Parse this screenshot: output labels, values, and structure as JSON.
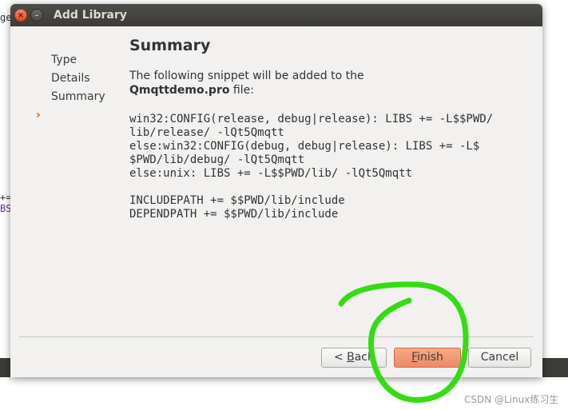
{
  "background": {
    "fragment_top": "ge",
    "fragment_mid1": "+=",
    "fragment_mid2": "BS"
  },
  "dialog": {
    "title": "Add Library",
    "close_glyph": "×",
    "minimize_glyph": "–"
  },
  "nav": {
    "items": [
      "Type",
      "Details",
      "Summary"
    ],
    "current_marker": "›"
  },
  "content": {
    "heading": "Summary",
    "intro_line1": "The following snippet will be added to the",
    "intro_file": "Qmqttdemo.pro",
    "intro_suffix": " file:",
    "snippet": "win32:CONFIG(release, debug|release): LIBS += -L$$PWD/\nlib/release/ -lQt5Qmqtt\nelse:win32:CONFIG(debug, debug|release): LIBS += -L$\n$PWD/lib/debug/ -lQt5Qmqtt\nelse:unix: LIBS += -L$$PWD/lib/ -lQt5Qmqtt\n\nINCLUDEPATH += $$PWD/lib/include\nDEPENDPATH += $$PWD/lib/include"
  },
  "buttons": {
    "back_prefix": "< ",
    "back_mnemonic": "B",
    "back_rest": "ack",
    "finish_mnemonic": "F",
    "finish_rest": "inish",
    "cancel": "Cancel"
  },
  "watermark": "CSDN @Linux练习生",
  "colors": {
    "accent": "#e95420",
    "finish_button": "#f09a78",
    "annotation": "#33dd11",
    "titlebar": "#3c3b37"
  }
}
